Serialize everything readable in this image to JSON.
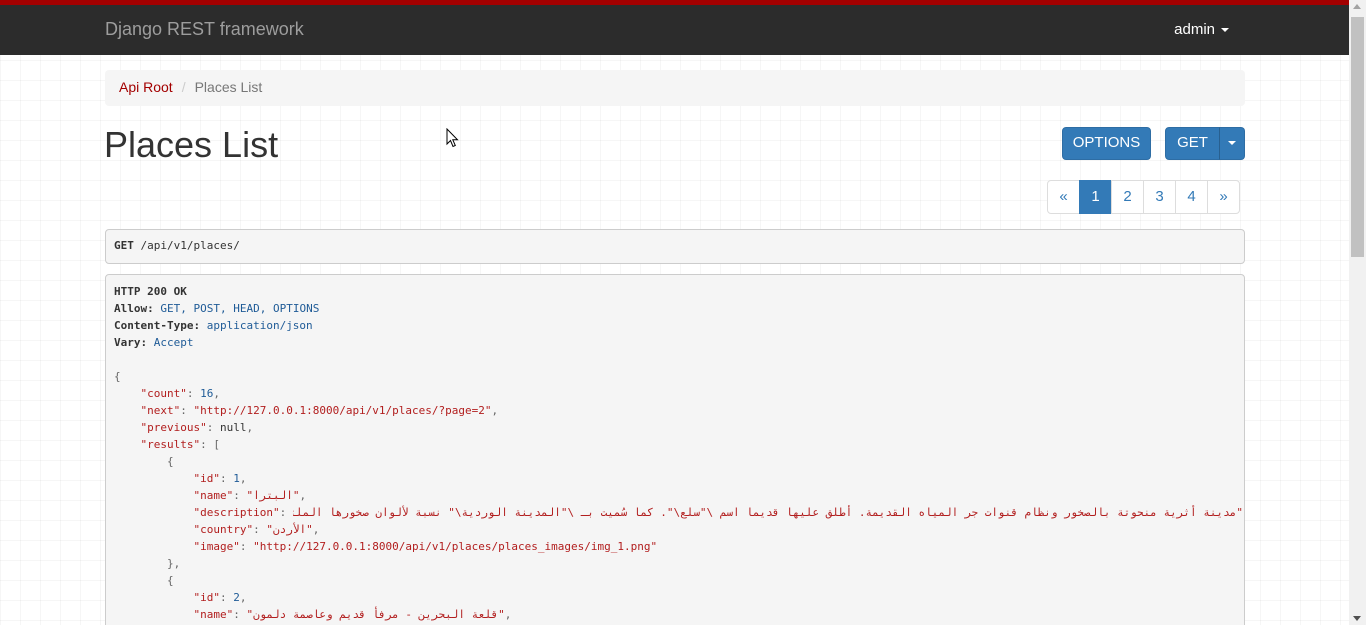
{
  "navbar": {
    "brand": "Django REST framework",
    "user": "admin",
    "accent_color": "#a30000",
    "background_color": "#2c2c2c"
  },
  "breadcrumb": {
    "root": "Api Root",
    "separator": "/",
    "current": "Places List"
  },
  "page": {
    "title": "Places List"
  },
  "buttons": {
    "options": "OPTIONS",
    "get": "GET"
  },
  "pagination": {
    "prev": "«",
    "pages": [
      "1",
      "2",
      "3",
      "4"
    ],
    "active": "1",
    "next": "»"
  },
  "request": {
    "method": "GET",
    "path": "/api/v1/places/"
  },
  "response": {
    "status": "HTTP 200 OK",
    "headers": [
      {
        "key": "Allow:",
        "value": "GET, POST, HEAD, OPTIONS"
      },
      {
        "key": "Content-Type:",
        "value": "application/json"
      },
      {
        "key": "Vary:",
        "value": "Accept"
      }
    ],
    "count": "16",
    "next": "\"http://127.0.0.1:8000/api/v1/places/?page=2\"",
    "previous": "null",
    "results": [
      {
        "id": "1",
        "name": "\"البترا\"",
        "description": "\"مدينة أثرية منحوتة بالصخور ونظام قنوات جر المياه القديمة. أطلق عليها قديما اسم \\\"سلع\\\". كما سُميت بـ \\\"المدينة الوردية\\\" نسبة لألوان صخورها الملتوية",
        "country": "\"الأردن\"",
        "image": "\"http://127.0.0.1:8000/api/v1/places/places_images/img_1.png\""
      },
      {
        "id": "2",
        "name": "\"قلعة البحرين - مرفأ قديم وعاصمة دلمون\""
      }
    ]
  }
}
